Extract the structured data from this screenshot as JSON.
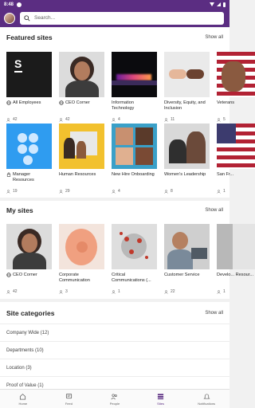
{
  "status": {
    "time": "8:48"
  },
  "search": {
    "placeholder": "Search..."
  },
  "featured": {
    "title": "Featured sites",
    "show_all": "Show all",
    "cards": [
      {
        "title": "All Employees",
        "count": "42",
        "icon": "globe-icon"
      },
      {
        "title": "CEO Corner",
        "count": "42",
        "icon": "globe-icon"
      },
      {
        "title": "Information Technology",
        "count": "4",
        "icon": ""
      },
      {
        "title": "Diversity, Equity, and Inclusion",
        "count": "11",
        "icon": ""
      },
      {
        "title": "Veterans",
        "count": "5",
        "icon": ""
      }
    ],
    "cards2": [
      {
        "title": "Manager Resources",
        "count": "19",
        "icon": "lock-icon"
      },
      {
        "title": "Human Resources",
        "count": "29",
        "icon": ""
      },
      {
        "title": "New Hire Onboarding",
        "count": "4",
        "icon": ""
      },
      {
        "title": "Women's Leadership",
        "count": "8",
        "icon": ""
      },
      {
        "title": "San Fr...",
        "count": "1",
        "icon": ""
      }
    ]
  },
  "mysites": {
    "title": "My sites",
    "show_all": "Show all",
    "cards": [
      {
        "title": "CEO Corner",
        "count": "42",
        "icon": "globe-icon"
      },
      {
        "title": "Corporate Communication",
        "count": "3",
        "icon": ""
      },
      {
        "title": "Critical Communications (...",
        "count": "1",
        "icon": ""
      },
      {
        "title": "Customer Service",
        "count": "22",
        "icon": ""
      },
      {
        "title": "Develo... Resour...",
        "count": "1",
        "icon": ""
      }
    ]
  },
  "categories": {
    "title": "Site categories",
    "show_all": "Show all",
    "items": [
      {
        "label": "Company Wide (12)"
      },
      {
        "label": "Departments (10)"
      },
      {
        "label": "Location (3)"
      },
      {
        "label": "Proof of Value (1)"
      }
    ]
  },
  "nav": {
    "items": [
      {
        "label": "Home",
        "icon": "home-icon"
      },
      {
        "label": "Feed",
        "icon": "feed-icon"
      },
      {
        "label": "People",
        "icon": "people-icon"
      },
      {
        "label": "Sites",
        "icon": "sites-icon"
      },
      {
        "label": "Notifications",
        "icon": "bell-icon"
      }
    ]
  },
  "colors": {
    "brand": "#5b2d82",
    "background": "#f1f1f1"
  }
}
